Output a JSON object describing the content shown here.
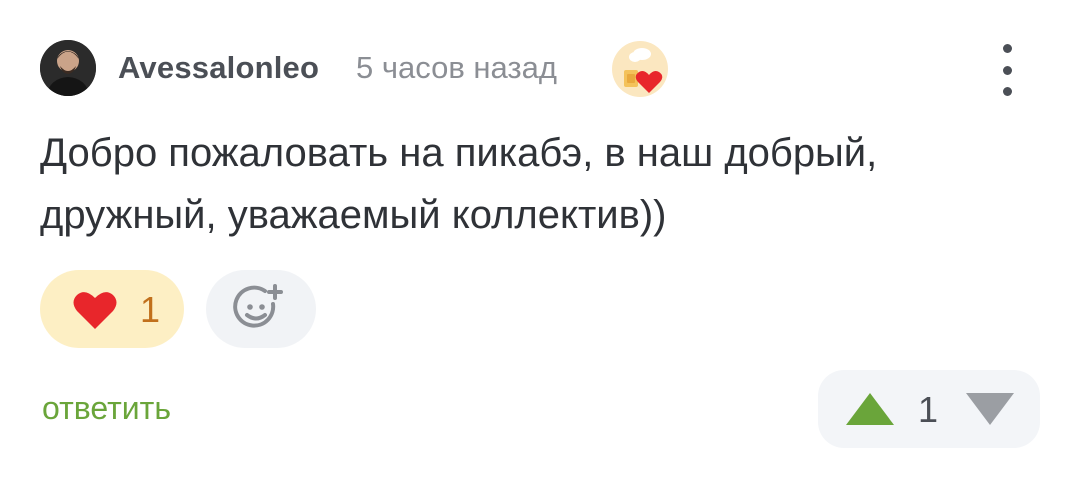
{
  "comment": {
    "author": "Avessalonleo",
    "time": "5 часов назад",
    "text": "Добро пожаловать на пикабэ, в наш добрый, дружный, уважаемый коллектив))",
    "reactions": {
      "like_count": "1"
    },
    "reply_label": "ответить",
    "rating": "1"
  },
  "colors": {
    "accent_green": "#6aa53a",
    "heart_red": "#e8262b",
    "like_bg": "#fdefc4",
    "vote_down_gray": "#9b9ea3"
  },
  "icons": [
    "avatar",
    "community-badge-icon",
    "more-icon",
    "heart-icon",
    "add-reaction-icon",
    "upvote-icon",
    "downvote-icon"
  ]
}
